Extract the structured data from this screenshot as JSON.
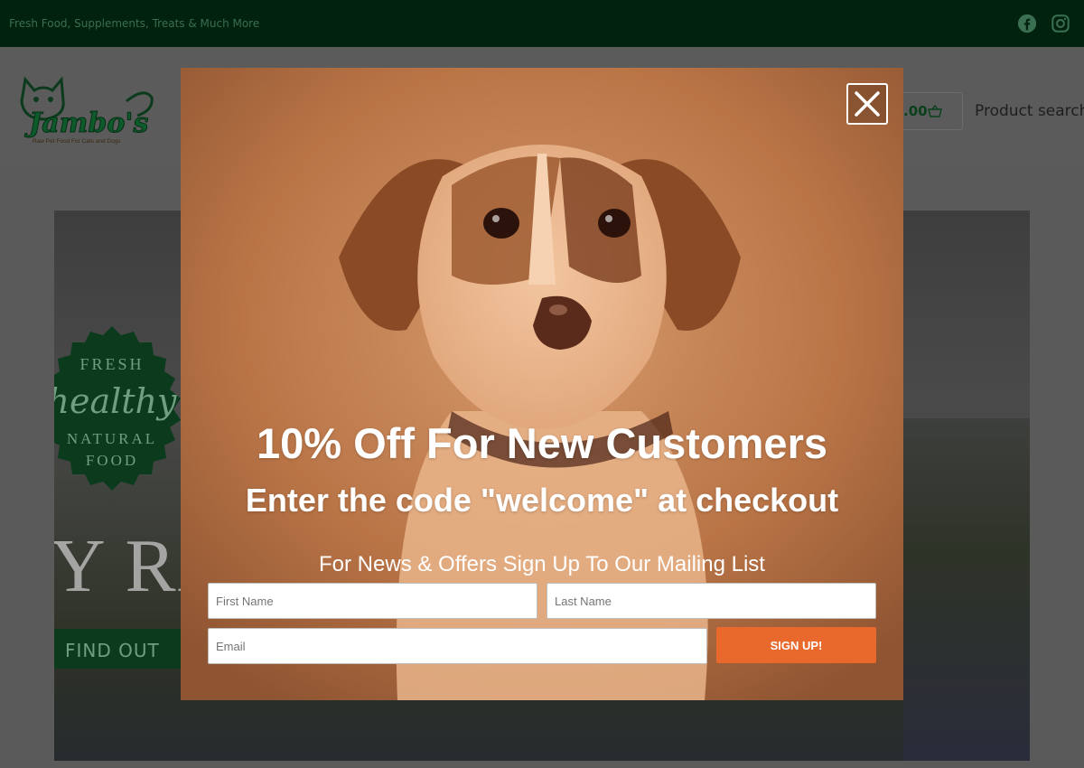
{
  "topbar": {
    "tagline": "Fresh Food, Supplements, Treats & Much More",
    "social_icons": [
      "facebook-icon",
      "instagram-icon"
    ]
  },
  "header": {
    "logo_text": "Jambo's",
    "logo_subtext": "Raw Pet Food For Cats and Dogs",
    "cart_total": ".00",
    "search_placeholder": "Product search..."
  },
  "hero": {
    "badge_lines": [
      "FRESH",
      "healthy",
      "NATURAL",
      "FOOD"
    ],
    "big_text": "Y RA",
    "find_out_label": "FIND OUT"
  },
  "popup": {
    "headline": "10% Off For New Customers",
    "subheadline": "Enter the code \"welcome\" at checkout",
    "signup_caption": "For News & Offers Sign Up To Our Mailing List",
    "first_name_placeholder": "First Name",
    "last_name_placeholder": "Last Name",
    "email_placeholder": "Email",
    "signup_label": "SIGN UP!",
    "close_icon": "close-icon"
  },
  "colors": {
    "topbar_bg": "#00220f",
    "brand_green": "#0c3a1d",
    "signup_orange": "#e8692b",
    "overlay_gray": "#5a5a5a"
  }
}
